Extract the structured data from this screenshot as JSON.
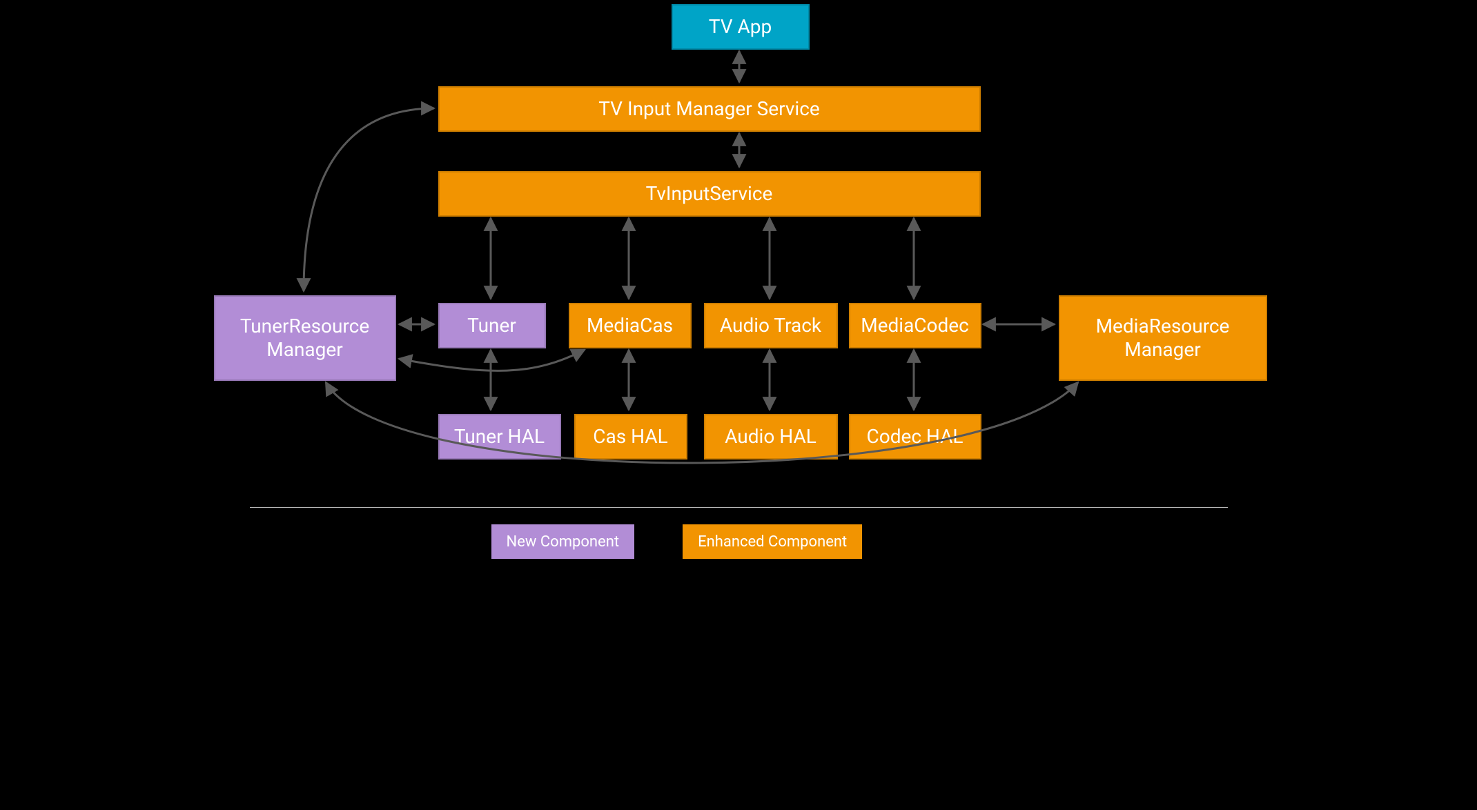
{
  "boxes": {
    "tv_app": "TV App",
    "tims": "TV Input Manager Service",
    "tis": "TvInputService",
    "trm_l1": "TunerResource",
    "trm_l2": "Manager",
    "mrm_l1": "MediaResource",
    "mrm_l2": "Manager",
    "tuner": "Tuner",
    "mediacas": "MediaCas",
    "audiotrack": "Audio Track",
    "mediacodec": "MediaCodec",
    "tuner_hal": "Tuner HAL",
    "cas_hal": "Cas HAL",
    "audio_hal": "Audio HAL",
    "codec_hal": "Codec HAL"
  },
  "legend": {
    "new": "New Component",
    "enhanced": "Enhanced Component"
  },
  "colors": {
    "blue": "#00a4c7",
    "orange": "#f29401",
    "purple": "#b28dd6",
    "arrow": "#595959"
  },
  "component_kinds": {
    "new": [
      "TunerResourceManager",
      "Tuner",
      "Tuner HAL"
    ],
    "enhanced": [
      "TV Input Manager Service",
      "TvInputService",
      "MediaCas",
      "Audio Track",
      "MediaCodec",
      "Cas HAL",
      "Audio HAL",
      "Codec HAL",
      "MediaResourceManager"
    ],
    "app": [
      "TV App"
    ]
  },
  "connections": [
    [
      "TV App",
      "TV Input Manager Service",
      "bidir"
    ],
    [
      "TV Input Manager Service",
      "TvInputService",
      "bidir"
    ],
    [
      "TvInputService",
      "Tuner",
      "bidir"
    ],
    [
      "TvInputService",
      "MediaCas",
      "bidir"
    ],
    [
      "TvInputService",
      "Audio Track",
      "bidir"
    ],
    [
      "TvInputService",
      "MediaCodec",
      "bidir"
    ],
    [
      "Tuner",
      "Tuner HAL",
      "bidir"
    ],
    [
      "MediaCas",
      "Cas HAL",
      "bidir"
    ],
    [
      "Audio Track",
      "Audio HAL",
      "bidir"
    ],
    [
      "MediaCodec",
      "Codec HAL",
      "bidir"
    ],
    [
      "TunerResourceManager",
      "Tuner",
      "bidir"
    ],
    [
      "MediaCodec",
      "MediaResourceManager",
      "bidir"
    ],
    [
      "TunerResourceManager",
      "TV Input Manager Service",
      "bidir-curved"
    ],
    [
      "TunerResourceManager",
      "MediaCas",
      "bidir-curved"
    ],
    [
      "TunerResourceManager",
      "MediaResourceManager",
      "bidir-curved"
    ]
  ]
}
